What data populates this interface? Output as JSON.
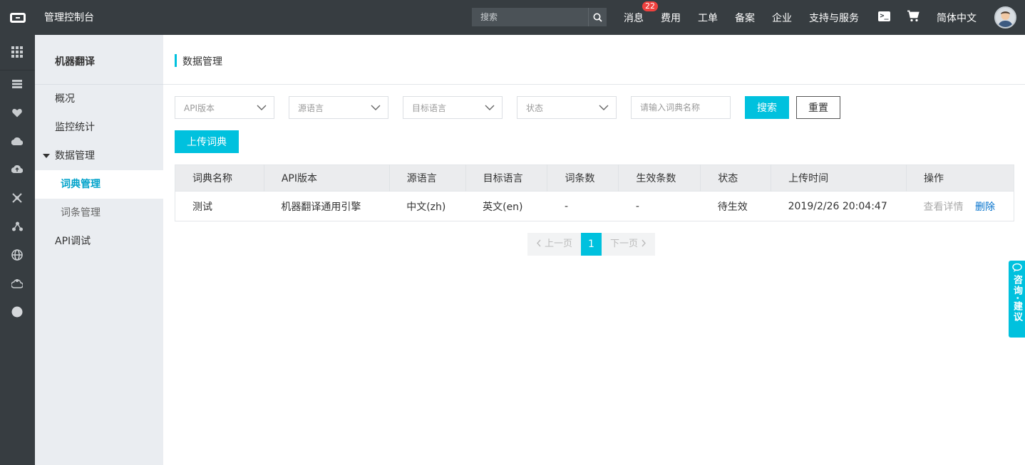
{
  "topbar": {
    "title": "管理控制台",
    "search_placeholder": "搜索",
    "nav": [
      {
        "label": "消息",
        "badge": "22"
      },
      {
        "label": "费用"
      },
      {
        "label": "工单"
      },
      {
        "label": "备案"
      },
      {
        "label": "企业"
      },
      {
        "label": "支持与服务"
      }
    ],
    "language": "简体中文"
  },
  "rail_icons": [
    "grid-icon",
    "list-icon",
    "heart-icon",
    "cloud-icon",
    "cloud-upload-icon",
    "shuffle-icon",
    "network-icon",
    "globe-icon",
    "gear-cloud-icon",
    "circle-icon"
  ],
  "sidebar": {
    "title": "机器翻译",
    "items": [
      {
        "label": "概况"
      },
      {
        "label": "监控统计"
      },
      {
        "label": "数据管理"
      },
      {
        "label": "词典管理"
      },
      {
        "label": "词条管理"
      },
      {
        "label": "API调试"
      }
    ]
  },
  "main": {
    "title": "数据管理",
    "filters": {
      "api_version": "API版本",
      "source_lang": "源语言",
      "target_lang": "目标语言",
      "status": "状态",
      "name_placeholder": "请输入词典名称"
    },
    "search_label": "搜索",
    "reset_label": "重置",
    "upload_label": "上传词典",
    "table": {
      "headers": [
        "词典名称",
        "API版本",
        "源语言",
        "目标语言",
        "词条数",
        "生效条数",
        "状态",
        "上传时间",
        "操作"
      ],
      "rows": [
        {
          "name": "测试",
          "api": "机器翻译通用引擎",
          "src": "中文(zh)",
          "tgt": "英文(en)",
          "count": "-",
          "effective": "-",
          "status": "待生效",
          "time": "2019/2/26 20:04:47",
          "view": "查看详情",
          "delete": "删除"
        }
      ]
    },
    "pager": {
      "prev": "上一页",
      "current": "1",
      "next": "下一页"
    }
  },
  "feedback": "咨询·建议",
  "colors": {
    "accent": "#00c1de",
    "topbar": "#373d41",
    "sidebar": "#eaedf1",
    "link": "#0070cc",
    "badge": "#f0413e"
  }
}
